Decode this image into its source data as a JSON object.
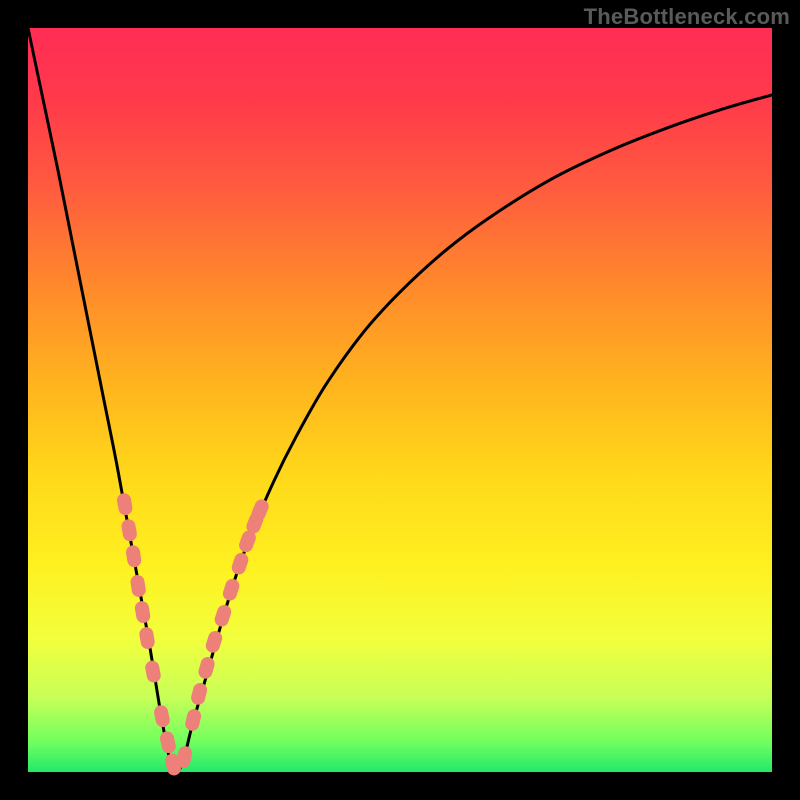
{
  "watermark": "TheBottleneck.com",
  "colors": {
    "page_bg": "#000000",
    "gradient_top": "#ff2d55",
    "gradient_bottom": "#23e86b",
    "curve": "#000000",
    "markers": "#ed8079",
    "watermark": "#5a5a5a"
  },
  "chart_data": {
    "type": "line",
    "title": "",
    "xlabel": "",
    "ylabel": "",
    "xlim": [
      0,
      100
    ],
    "ylim": [
      0,
      100
    ],
    "series": [
      {
        "name": "bottleneck-curve",
        "x": [
          0,
          2,
          4,
          6,
          8,
          10,
          12,
          14,
          16,
          17,
          18,
          19,
          20,
          21,
          22,
          24,
          26,
          28,
          30,
          33,
          36,
          40,
          45,
          50,
          56,
          62,
          70,
          78,
          86,
          94,
          100
        ],
        "y": [
          100,
          90.5,
          81,
          71,
          61,
          51,
          41,
          30,
          19,
          13,
          7,
          2,
          0,
          2,
          6,
          13,
          20,
          26.5,
          32,
          39,
          45,
          52,
          59,
          64.5,
          70,
          74.5,
          79.5,
          83.4,
          86.6,
          89.3,
          91
        ]
      }
    ],
    "markers": [
      {
        "name": "left-branch-markers",
        "x": [
          13.0,
          13.6,
          14.2,
          14.8,
          15.4,
          16.0,
          16.8,
          18.0,
          18.8,
          19.5
        ],
        "y": [
          36.0,
          32.5,
          29.0,
          25.0,
          21.5,
          18.0,
          13.5,
          7.5,
          4.0,
          1.0
        ]
      },
      {
        "name": "right-branch-markers",
        "x": [
          21.0,
          22.2,
          23.0,
          24.0,
          25.0,
          26.2,
          27.3,
          28.5,
          29.5,
          30.5,
          31.2
        ],
        "y": [
          2.0,
          7.0,
          10.5,
          14.0,
          17.5,
          21.0,
          24.5,
          28.0,
          31.0,
          33.5,
          35.2
        ]
      }
    ]
  }
}
